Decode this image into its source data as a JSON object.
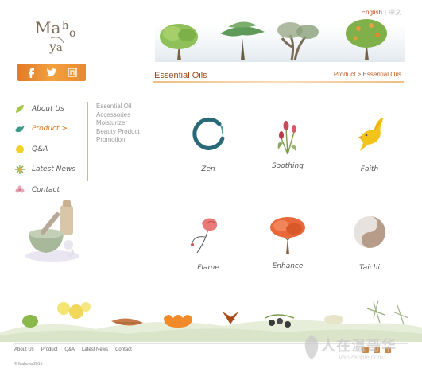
{
  "brand": {
    "logo_text": "Maho ya"
  },
  "language": {
    "english": "English",
    "separator": "|",
    "chinese": "中文"
  },
  "section": {
    "title": "Essential Oils",
    "breadcrumb": "Product > Essential Oils"
  },
  "nav": {
    "items": [
      {
        "label": "About Us",
        "icon": "leaf-icon",
        "color": "#9bbf3a"
      },
      {
        "label": "Product >",
        "icon": "bird-icon",
        "color": "#3a9a8a"
      },
      {
        "label": "Q&A",
        "icon": "yellow-dot-icon",
        "color": "#f2d22a"
      },
      {
        "label": "Latest News",
        "icon": "flower-icon",
        "color": "#8aa84a"
      },
      {
        "label": "Contact",
        "icon": "pink-flower-icon",
        "color": "#e0a0b0"
      }
    ]
  },
  "subnav": {
    "items": [
      "Essential Oil",
      "Accessories",
      "Moisturizer",
      "Beauty Product",
      "Promotion"
    ]
  },
  "products": [
    {
      "label": "Zen",
      "icon": "zen-circle-icon"
    },
    {
      "label": "Soothing",
      "icon": "tulips-icon"
    },
    {
      "label": "Faith",
      "icon": "yellow-bird-icon"
    },
    {
      "label": "Flame",
      "icon": "poppy-icon"
    },
    {
      "label": "Enhance",
      "icon": "red-tree-icon"
    },
    {
      "label": "Taichi",
      "icon": "yin-yang-icon"
    }
  ],
  "footer": {
    "links": [
      "About Us",
      "Product",
      "Q&A",
      "Latest News",
      "Contact"
    ],
    "copyright": "© Mahoya 2015"
  },
  "watermark": {
    "text": "人在温哥华",
    "sub": "VanPeople.com"
  },
  "colors": {
    "accent": "#d4731f",
    "social_bar": "#f0963a"
  }
}
